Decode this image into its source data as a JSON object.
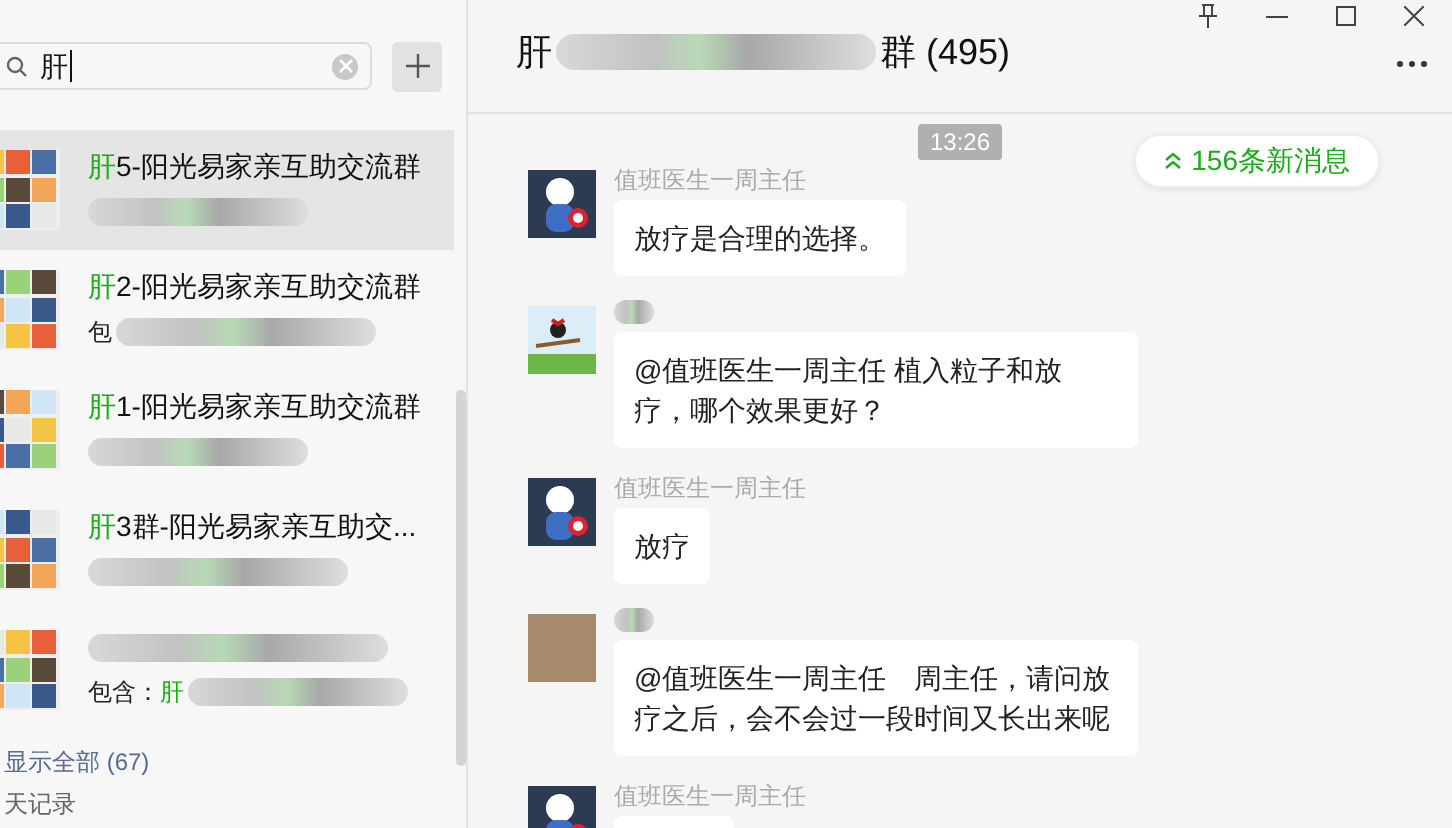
{
  "search": {
    "value": "肝"
  },
  "results": [
    {
      "match": "肝",
      "name": "5-阳光易家亲互助交流群",
      "selected": true
    },
    {
      "match": "肝",
      "name": "2-阳光易家亲互助交流群",
      "subtitle_prefix": "包",
      "selected": false
    },
    {
      "match": "肝",
      "name": "1-阳光易家亲互助交流群",
      "selected": false
    },
    {
      "match": "肝",
      "name": "3群-阳光易家亲互助交...",
      "selected": false
    },
    {
      "subtitle_prefix": "包含：",
      "subtitle_match": "肝",
      "selected": false
    }
  ],
  "show_all": "显示全部 (67)",
  "section_label": "天记录",
  "chat": {
    "title_start": "肝",
    "title_end": "群 (495)",
    "time": "13:26",
    "new_messages": "156条新消息",
    "messages": [
      {
        "sender": "值班医生一周主任",
        "kind": "bear",
        "text": "放疗是合理的选择。"
      },
      {
        "kind": "cartoon",
        "text": "@值班医生一周主任 植入粒子和放疗，哪个效果更好？"
      },
      {
        "sender": "值班医生一周主任",
        "kind": "bear",
        "text": "放疗"
      },
      {
        "kind": "photo",
        "text": "@值班医生一周主任　周主任，请问放疗之后，会不会过一段时间又长出来呢"
      },
      {
        "sender": "值班医生一周主任",
        "kind": "bear"
      }
    ]
  }
}
